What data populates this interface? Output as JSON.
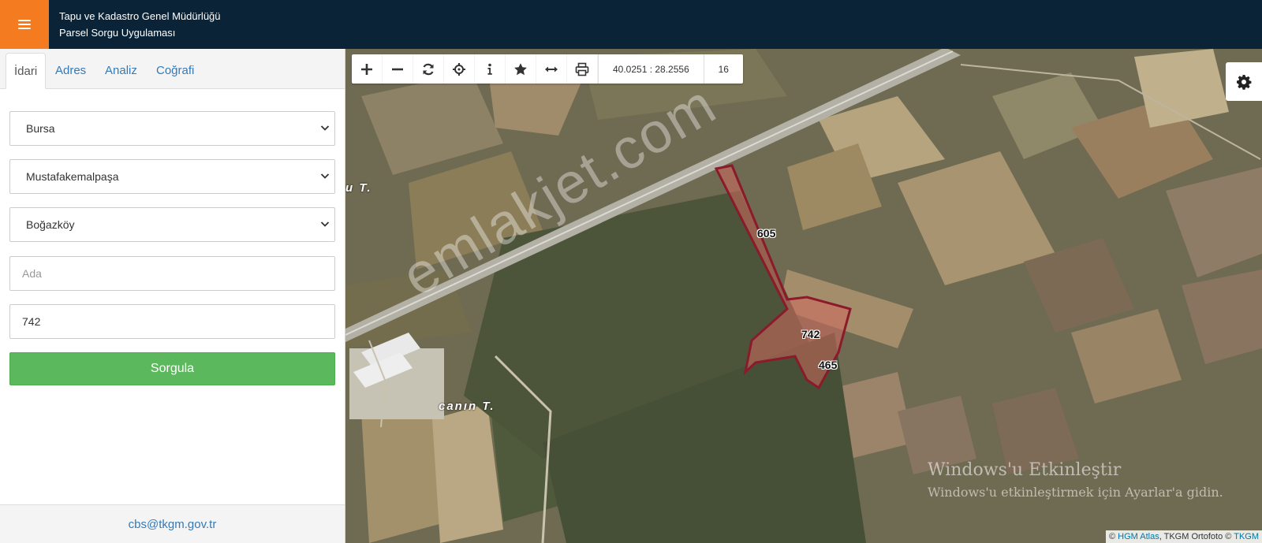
{
  "header": {
    "title_line1": "Tapu ve Kadastro Genel Müdürlüğü",
    "title_line2": "Parsel Sorgu Uygulaması"
  },
  "sidebar": {
    "tabs": [
      "İdari",
      "Adres",
      "Analiz",
      "Coğrafi"
    ],
    "active_tab": "İdari",
    "il": "Bursa",
    "ilce": "Mustafakemalpaşa",
    "mahalle": "Boğazköy",
    "ada_placeholder": "Ada",
    "parsel_value": "742",
    "submit_label": "Sorgula",
    "footer_email": "cbs@tkgm.gov.tr"
  },
  "map": {
    "toolbar_icons": [
      "plus-icon",
      "minus-icon",
      "refresh-icon",
      "locate-icon",
      "info-icon",
      "star-icon",
      "measure-icon",
      "print-icon"
    ],
    "coordinates": "40.0251 : 28.2556",
    "zoom_level": "16",
    "place_labels": [
      "u T.",
      "canın T."
    ],
    "parcels": [
      "605",
      "742",
      "465"
    ],
    "watermark": "emlakjet.com",
    "windows_notice_title": "Windows'u Etkinleştir",
    "windows_notice_body": "Windows'u etkinleştirmek için Ayarlar'a gidin.",
    "attribution": {
      "copy1": "©",
      "link1": "HGM Atlas",
      "mid": ", TKGM Ortofoto ©",
      "link2": "TKGM"
    },
    "parcel_color": "#8b1a2b"
  }
}
